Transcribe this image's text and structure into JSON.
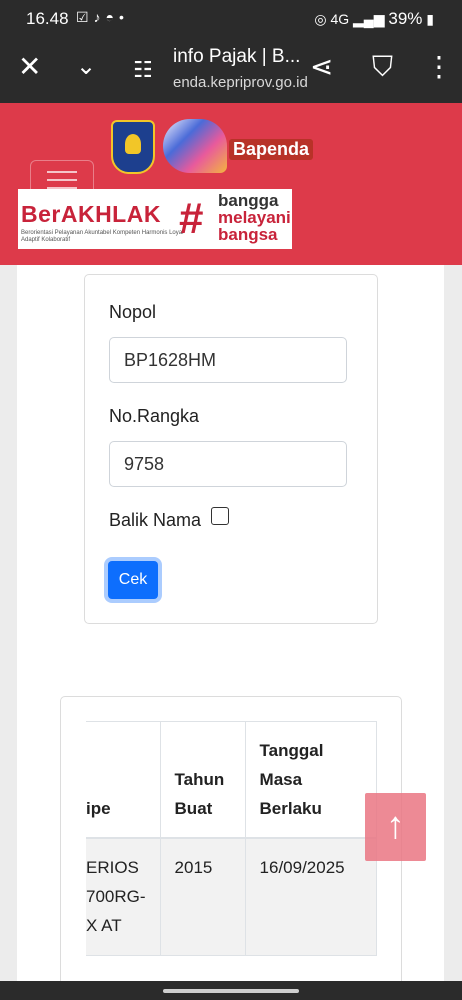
{
  "status_bar": {
    "time": "16.48",
    "network": "4G",
    "battery": "39%"
  },
  "browser": {
    "title": "info Pajak | B...",
    "url": "enda.kepriprov.go.id"
  },
  "header": {
    "brand": "Bapenda",
    "banner": {
      "berakhlak": "BerAKHLAK",
      "tagline": "Berorientasi Pelayanan Akuntabel Kompeten Harmonis Loyal Adaptif Kolaboratif",
      "hash": "#",
      "line1": "bangga",
      "line2": "melayani",
      "line3": "bangsa"
    }
  },
  "form": {
    "nopol_label": "Nopol",
    "nopol_value": "BP1628HM",
    "rangka_label": "No.Rangka",
    "rangka_value": "9758",
    "balik_nama_label": "Balik Nama",
    "balik_nama_checked": false,
    "submit_label": "Cek"
  },
  "result_table": {
    "headers": [
      "ipe",
      "Tahun Buat",
      "Tanggal Masa Berlaku"
    ],
    "rows": [
      [
        "ERIOS 700RG-X AT",
        "2015",
        "16/09/2025"
      ]
    ]
  },
  "icons": {
    "close": "close-icon",
    "chevron": "chevron-down-icon",
    "site_settings": "tune-icon",
    "share": "share-icon",
    "bookmark": "bookmark-icon",
    "more": "more-vert-icon",
    "scroll_top": "arrow-up-icon"
  }
}
